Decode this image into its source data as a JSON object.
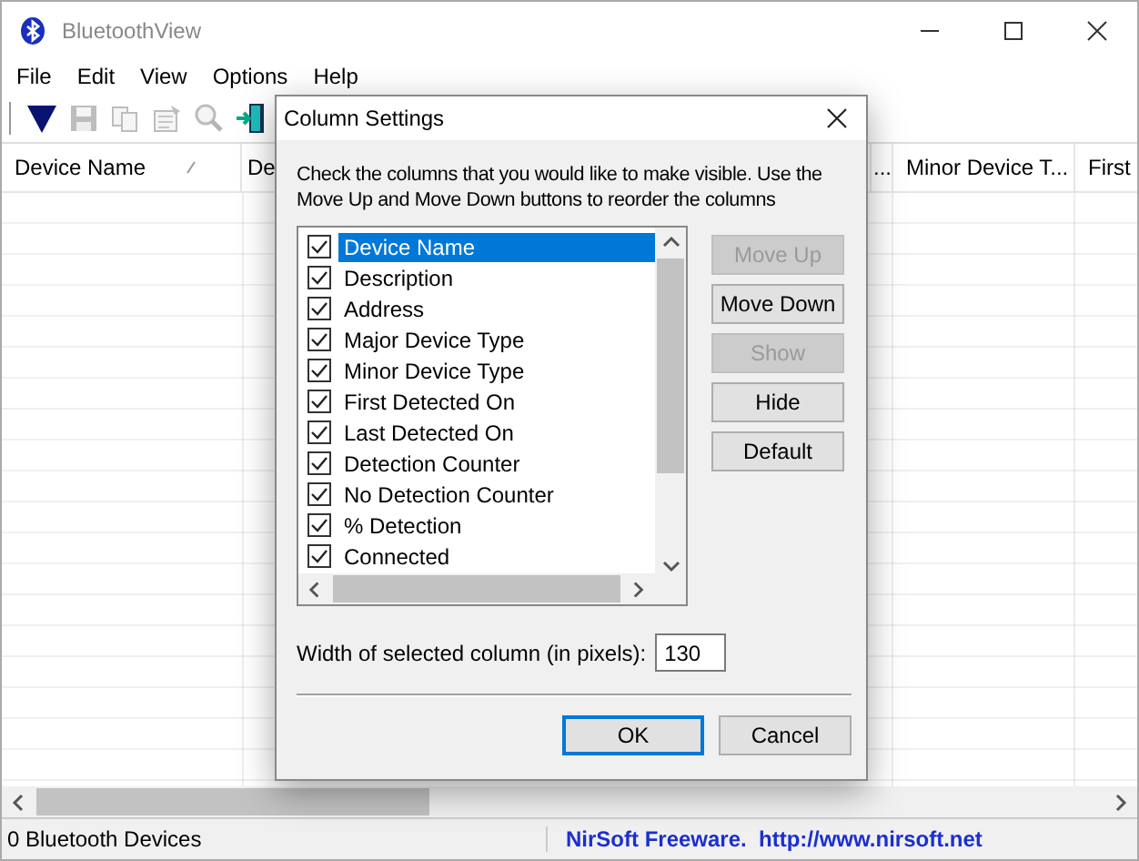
{
  "window": {
    "title": "BluetoothView"
  },
  "menu": [
    "File",
    "Edit",
    "View",
    "Options",
    "Help"
  ],
  "toolbar": [
    {
      "kind": "filter",
      "disabled": false
    },
    {
      "kind": "save",
      "disabled": true
    },
    {
      "kind": "copy",
      "disabled": true
    },
    {
      "kind": "properties",
      "disabled": true
    },
    {
      "kind": "find",
      "disabled": true
    },
    {
      "kind": "exit",
      "disabled": false
    }
  ],
  "columns": [
    {
      "label": "Device Name",
      "sorted": true
    },
    {
      "label": "De",
      "sorted": false
    },
    {
      "label": "...",
      "sorted": false
    },
    {
      "label": "Minor Device T...",
      "sorted": false
    },
    {
      "label": "First",
      "sorted": false
    }
  ],
  "status_bar": {
    "count": "0 Bluetooth Devices",
    "credit": "NirSoft Freeware.  http://www.nirsoft.net"
  },
  "dialog": {
    "title": "Column Settings",
    "instructions": "Check the columns that you would like to make visible. Use the Move Up and Move Down buttons to reorder the columns",
    "items": [
      {
        "label": "Device Name",
        "checked": true,
        "selected": true
      },
      {
        "label": "Description",
        "checked": true,
        "selected": false
      },
      {
        "label": "Address",
        "checked": true,
        "selected": false
      },
      {
        "label": "Major Device Type",
        "checked": true,
        "selected": false
      },
      {
        "label": "Minor Device Type",
        "checked": true,
        "selected": false
      },
      {
        "label": "First Detected On",
        "checked": true,
        "selected": false
      },
      {
        "label": "Last Detected On",
        "checked": true,
        "selected": false
      },
      {
        "label": "Detection Counter",
        "checked": true,
        "selected": false
      },
      {
        "label": "No Detection Counter",
        "checked": true,
        "selected": false
      },
      {
        "label": "% Detection",
        "checked": true,
        "selected": false
      },
      {
        "label": "Connected",
        "checked": true,
        "selected": false
      }
    ],
    "side_buttons": [
      {
        "label": "Move Up",
        "disabled": true
      },
      {
        "label": "Move Down",
        "disabled": false
      },
      {
        "label": "Show",
        "disabled": true
      },
      {
        "label": "Hide",
        "disabled": false
      },
      {
        "label": "Default",
        "disabled": false
      }
    ],
    "width_label": "Width of selected column (in pixels):",
    "width_value": "130",
    "ok": "OK",
    "cancel": "Cancel"
  }
}
